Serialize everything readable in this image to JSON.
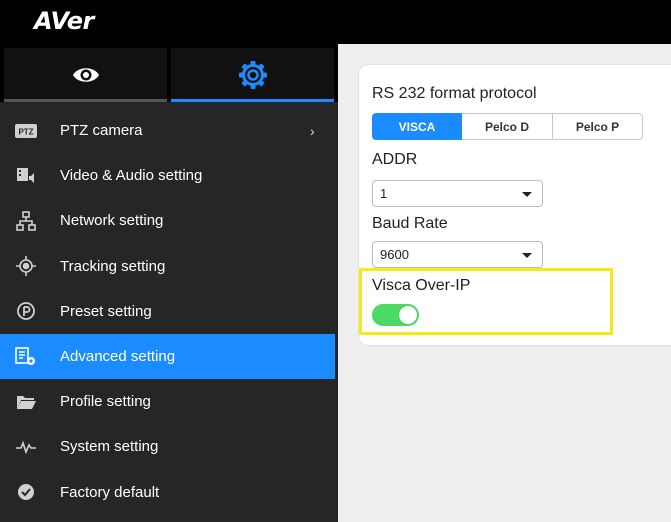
{
  "app": {
    "logo_text": "AVer"
  },
  "tabs": {
    "view_icon": "eye-icon",
    "settings_icon": "gear-icon",
    "active": "settings"
  },
  "sidebar": {
    "items": [
      {
        "label": "PTZ camera",
        "icon": "ptz-icon",
        "has_chevron": true,
        "chevron": "›"
      },
      {
        "label": "Video & Audio setting",
        "icon": "video-audio-icon"
      },
      {
        "label": "Network setting",
        "icon": "network-icon"
      },
      {
        "label": "Tracking setting",
        "icon": "tracking-icon"
      },
      {
        "label": "Preset setting",
        "icon": "preset-icon"
      },
      {
        "label": "Advanced setting",
        "icon": "advanced-icon",
        "active": true
      },
      {
        "label": "Profile setting",
        "icon": "folder-icon"
      },
      {
        "label": "System setting",
        "icon": "pulse-icon"
      },
      {
        "label": "Factory default",
        "icon": "check-circle-icon"
      }
    ],
    "ptz_icon_text": "PTZ"
  },
  "main": {
    "protocol_label": "RS 232 format protocol",
    "protocol_options": [
      "VISCA",
      "Pelco D",
      "Pelco P"
    ],
    "protocol_selected": "VISCA",
    "addr_label": "ADDR",
    "addr_value": "1",
    "baud_label": "Baud Rate",
    "baud_value": "9600",
    "visca_ip_label": "Visca Over-IP",
    "visca_ip_on": true
  },
  "colors": {
    "accent": "#1a8cff",
    "toggle_on": "#4cd964",
    "highlight": "#f2ec16",
    "sidebar_bg": "#262626",
    "topbar_bg": "#000000"
  }
}
